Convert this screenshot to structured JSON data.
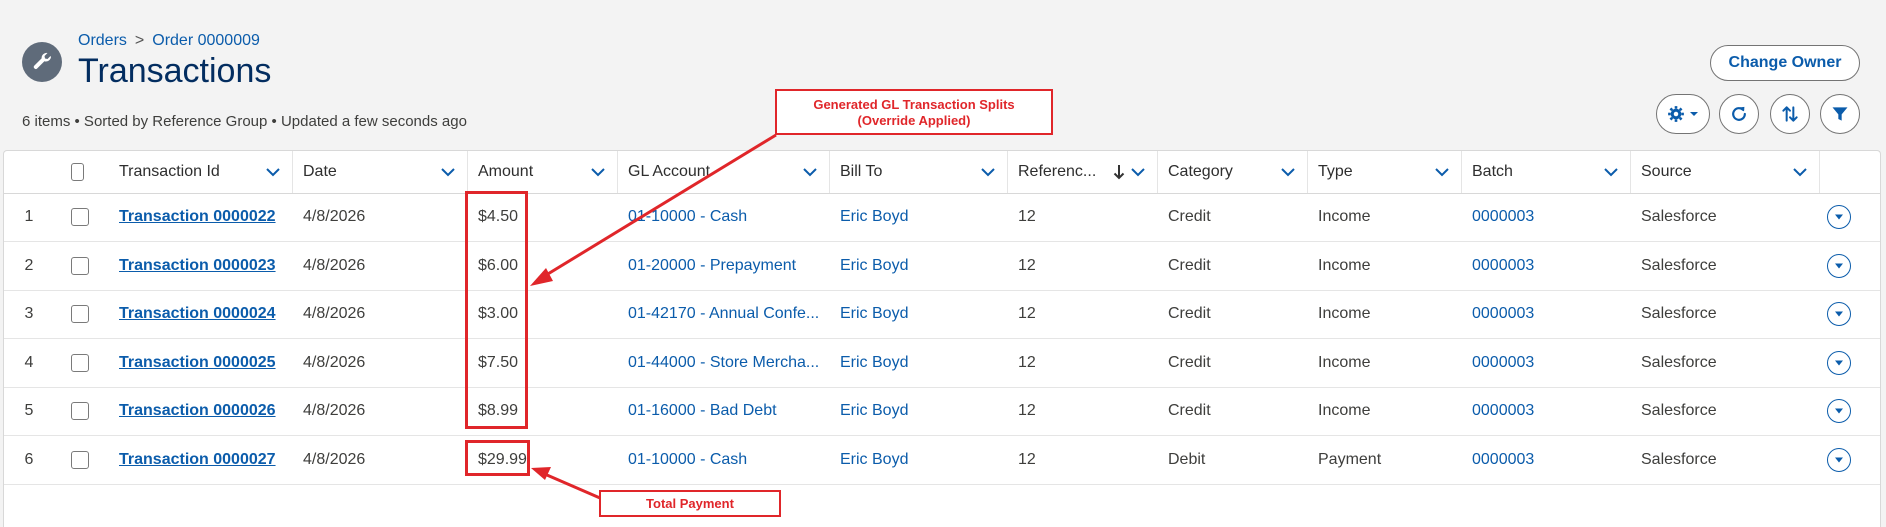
{
  "breadcrumb": {
    "parent": "Orders",
    "separator": ">",
    "current": "Order 0000009"
  },
  "page_title": "Transactions",
  "meta": "6 items • Sorted by Reference Group • Updated a few seconds ago",
  "actions": {
    "change_owner": "Change Owner"
  },
  "columns": {
    "transaction_id": "Transaction Id",
    "date": "Date",
    "amount": "Amount",
    "gl_account": "GL Account",
    "bill_to": "Bill To",
    "reference": "Referenc...",
    "category": "Category",
    "type": "Type",
    "batch": "Batch",
    "source": "Source"
  },
  "rows": [
    {
      "num": "1",
      "id": "Transaction 0000022",
      "date": "4/8/2026",
      "amount": "$4.50",
      "gl": "01-10000 - Cash",
      "bill_to": "Eric Boyd",
      "ref": "12",
      "category": "Credit",
      "type": "Income",
      "batch": "0000003",
      "source": "Salesforce"
    },
    {
      "num": "2",
      "id": "Transaction 0000023",
      "date": "4/8/2026",
      "amount": "$6.00",
      "gl": "01-20000 - Prepayment",
      "bill_to": "Eric Boyd",
      "ref": "12",
      "category": "Credit",
      "type": "Income",
      "batch": "0000003",
      "source": "Salesforce"
    },
    {
      "num": "3",
      "id": "Transaction 0000024",
      "date": "4/8/2026",
      "amount": "$3.00",
      "gl": "01-42170 - Annual Confe...",
      "bill_to": "Eric Boyd",
      "ref": "12",
      "category": "Credit",
      "type": "Income",
      "batch": "0000003",
      "source": "Salesforce"
    },
    {
      "num": "4",
      "id": "Transaction 0000025",
      "date": "4/8/2026",
      "amount": "$7.50",
      "gl": "01-44000 - Store Mercha...",
      "bill_to": "Eric Boyd",
      "ref": "12",
      "category": "Credit",
      "type": "Income",
      "batch": "0000003",
      "source": "Salesforce"
    },
    {
      "num": "5",
      "id": "Transaction 0000026",
      "date": "4/8/2026",
      "amount": "$8.99",
      "gl": "01-16000 - Bad Debt",
      "bill_to": "Eric Boyd",
      "ref": "12",
      "category": "Credit",
      "type": "Income",
      "batch": "0000003",
      "source": "Salesforce"
    },
    {
      "num": "6",
      "id": "Transaction 0000027",
      "date": "4/8/2026",
      "amount": "$29.99",
      "gl": "01-10000 - Cash",
      "bill_to": "Eric Boyd",
      "ref": "12",
      "category": "Debit",
      "type": "Payment",
      "batch": "0000003",
      "source": "Salesforce"
    }
  ],
  "annotations": {
    "splits_line1": "Generated GL Transaction Splits",
    "splits_line2": "(Override Applied)",
    "total": "Total Payment"
  },
  "icons": {
    "object": "wrench-icon",
    "settings": "gear-icon",
    "refresh": "refresh-icon",
    "sort": "sort-icon",
    "filter": "filter-icon"
  },
  "colors": {
    "brand_link": "#0b5cab",
    "title": "#032d60",
    "annotation": "#e0262a"
  }
}
